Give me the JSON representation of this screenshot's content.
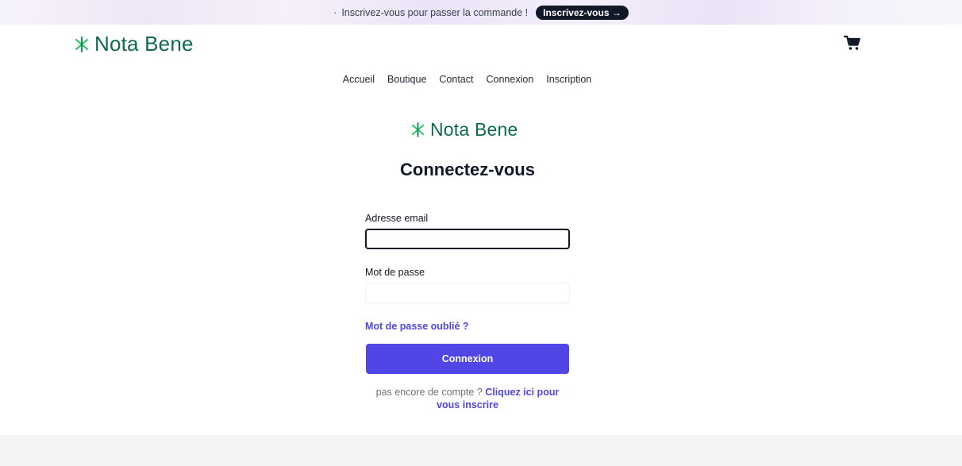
{
  "banner": {
    "separator": "·",
    "message": "Inscrivez-vous pour passer la commande !",
    "cta_label": "Inscrivez-vous →"
  },
  "header": {
    "brand": "Nota Bene",
    "cart_icon": "shopping-cart-icon"
  },
  "nav": {
    "items": [
      "Accueil",
      "Boutique",
      "Contact",
      "Connexion",
      "Inscription"
    ]
  },
  "login": {
    "brand": "Nota Bene",
    "title": "Connectez-vous",
    "email_label": "Adresse email",
    "email_value": "",
    "password_label": "Mot de passe",
    "password_value": "",
    "forgot_label": "Mot de passe oublié ?",
    "submit_label": "Connexion",
    "signup_prompt": "pas encore de compte ?",
    "signup_link": "Cliquez ici pour vous inscrire"
  },
  "colors": {
    "brand_green": "#0e6b4a",
    "accent": "#4f46e5",
    "logo_mark": "#22c55e"
  }
}
